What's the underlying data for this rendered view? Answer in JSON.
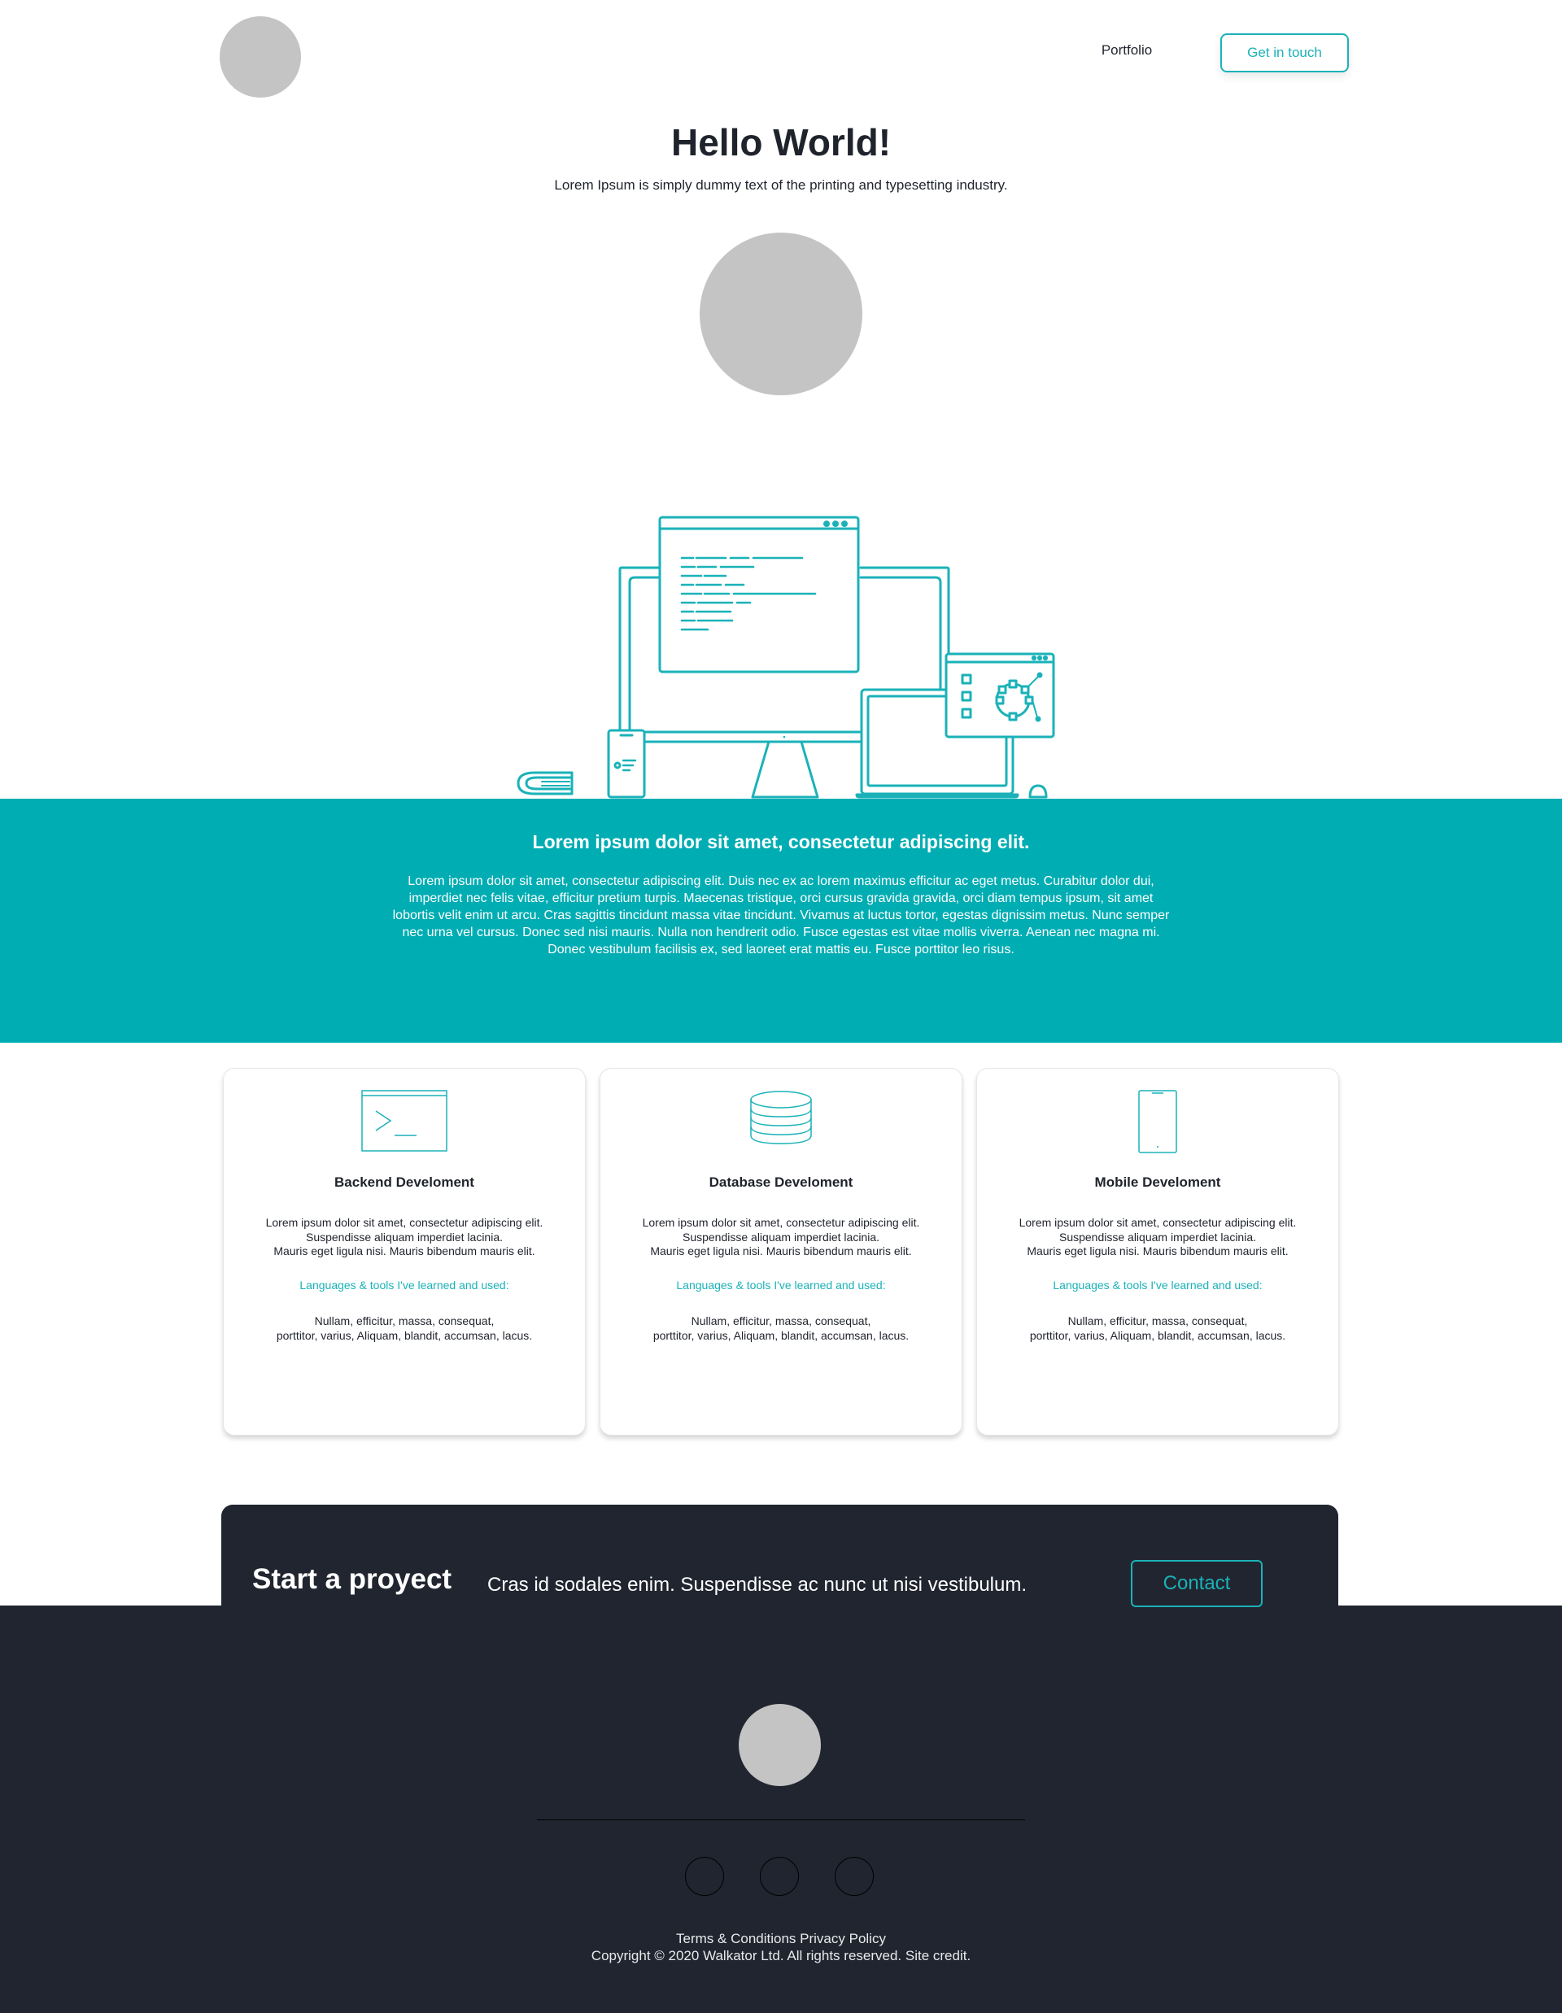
{
  "brand": {
    "accent": "#1ab2b8",
    "band": "#00adb3",
    "dark": "#212530",
    "placeholder": "#c4c4c4"
  },
  "header": {
    "logo_icon": "logo-placeholder-circle",
    "nav": {
      "portfolio": "Portfolio",
      "get_in_touch": "Get in touch"
    }
  },
  "hero": {
    "title": "Hello World!",
    "subtitle": "Lorem Ipsum is simply dummy text of the printing and typesetting industry.",
    "avatar_icon": "avatar-placeholder-circle",
    "illustration": "workspace-devices-illustration"
  },
  "about": {
    "title": "Lorem ipsum dolor sit amet, consectetur adipiscing elit.",
    "body": "Lorem ipsum dolor sit amet, consectetur adipiscing elit. Duis nec ex ac lorem maximus efficitur ac eget metus. Curabitur dolor dui, imperdiet nec felis vitae, efficitur pretium turpis. Maecenas tristique, orci cursus gravida gravida, orci diam tempus ipsum, sit amet lobortis velit enim ut arcu. Cras sagittis tincidunt massa vitae tincidunt. Vivamus at luctus tortor, egestas dignissim metus. Nunc semper nec urna vel cursus. Donec sed nisi mauris. Nulla non hendrerit odio. Fusce egestas est vitae mollis viverra. Aenean nec magna mi. Donec vestibulum facilisis ex, sed laoreet erat mattis eu. Fusce porttitor leo risus."
  },
  "services": [
    {
      "icon": "terminal-icon",
      "title": "Backend Develoment",
      "desc": [
        "Lorem ipsum dolor sit amet, consectetur adipiscing elit.",
        "Suspendisse aliquam imperdiet lacinia.",
        "Mauris eget ligula nisi. Mauris bibendum mauris elit."
      ],
      "tools_heading": "Languages & tools I've learned and used:",
      "tools": [
        "Nullam, efficitur, massa, consequat,",
        "porttitor, varius, Aliquam, blandit, accumsan, lacus."
      ]
    },
    {
      "icon": "database-icon",
      "title": "Database Develoment",
      "desc": [
        "Lorem ipsum dolor sit amet, consectetur adipiscing elit.",
        "Suspendisse aliquam imperdiet lacinia.",
        "Mauris eget ligula nisi. Mauris bibendum mauris elit."
      ],
      "tools_heading": "Languages & tools I've learned and used:",
      "tools": [
        "Nullam, efficitur, massa, consequat,",
        "porttitor, varius, Aliquam, blandit, accumsan, lacus."
      ]
    },
    {
      "icon": "mobile-phone-icon",
      "title": "Mobile Develoment",
      "desc": [
        "Lorem ipsum dolor sit amet, consectetur adipiscing elit.",
        "Suspendisse aliquam imperdiet lacinia.",
        "Mauris eget ligula nisi. Mauris bibendum mauris elit."
      ],
      "tools_heading": "Languages & tools I've learned and used:",
      "tools": [
        "Nullam, efficitur, massa, consequat,",
        "porttitor, varius, Aliquam, blandit, accumsan, lacus."
      ]
    }
  ],
  "cta": {
    "title": "Start a proyect",
    "text": "Cras id sodales enim. Suspendisse ac nunc ut nisi vestibulum.",
    "button": "Contact"
  },
  "footer": {
    "logo_icon": "logo-placeholder-circle",
    "social_icons": [
      "social-icon-1",
      "social-icon-2",
      "social-icon-3"
    ],
    "links": {
      "terms": "Terms & Conditions",
      "privacy": "Privacy Policy"
    },
    "copyright": "Copyright © 2020 Walkator Ltd. All rights reserved. Site credit."
  }
}
